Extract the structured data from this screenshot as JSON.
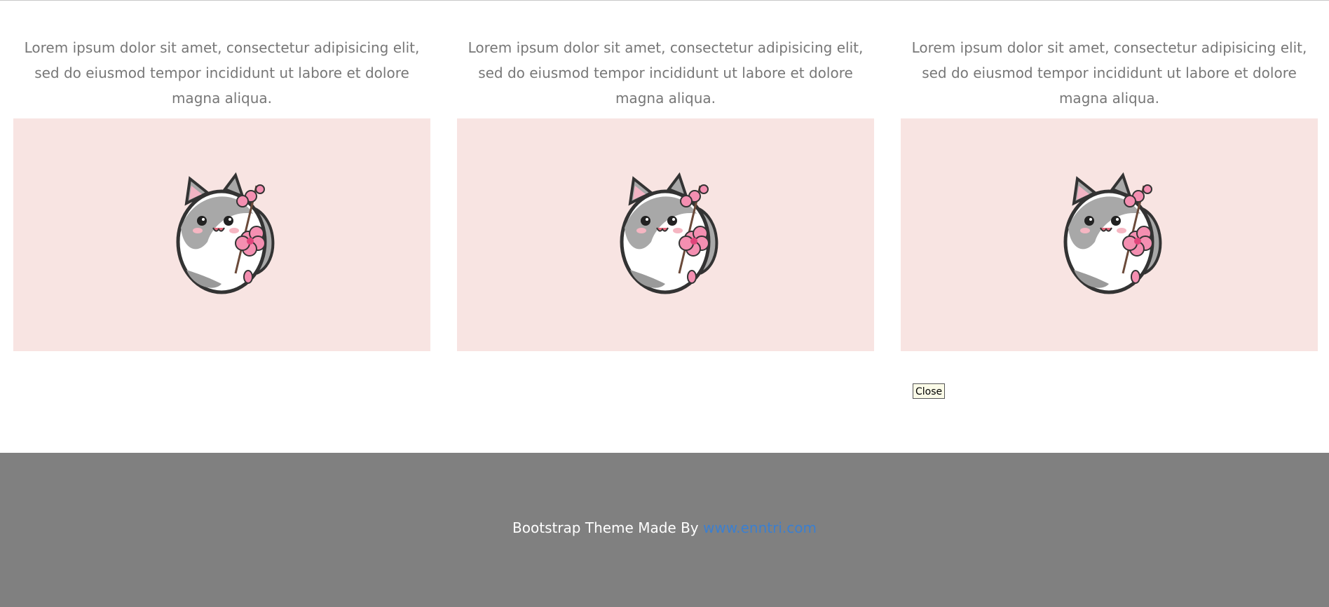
{
  "cards": [
    {
      "text": "Lorem ipsum dolor sit amet, consectetur adipisicing elit, sed do eiusmod tempor incididunt ut labore et dolore magna aliqua.",
      "image": "cat-with-cherry-blossom"
    },
    {
      "text": "Lorem ipsum dolor sit amet, consectetur adipisicing elit, sed do eiusmod tempor incididunt ut labore et dolore magna aliqua.",
      "image": "cat-with-cherry-blossom"
    },
    {
      "text": "Lorem ipsum dolor sit amet, consectetur adipisicing elit, sed do eiusmod tempor incididunt ut labore et dolore magna aliqua.",
      "image": "cat-with-cherry-blossom"
    }
  ],
  "close_button": {
    "label": "Close"
  },
  "footer": {
    "text": "Bootstrap Theme Made By",
    "link_label": "www.enntri.com"
  },
  "colors": {
    "image_background": "#f8e4e2",
    "footer_background": "#808080",
    "body_text": "#777777",
    "link": "#3b7fd0"
  }
}
